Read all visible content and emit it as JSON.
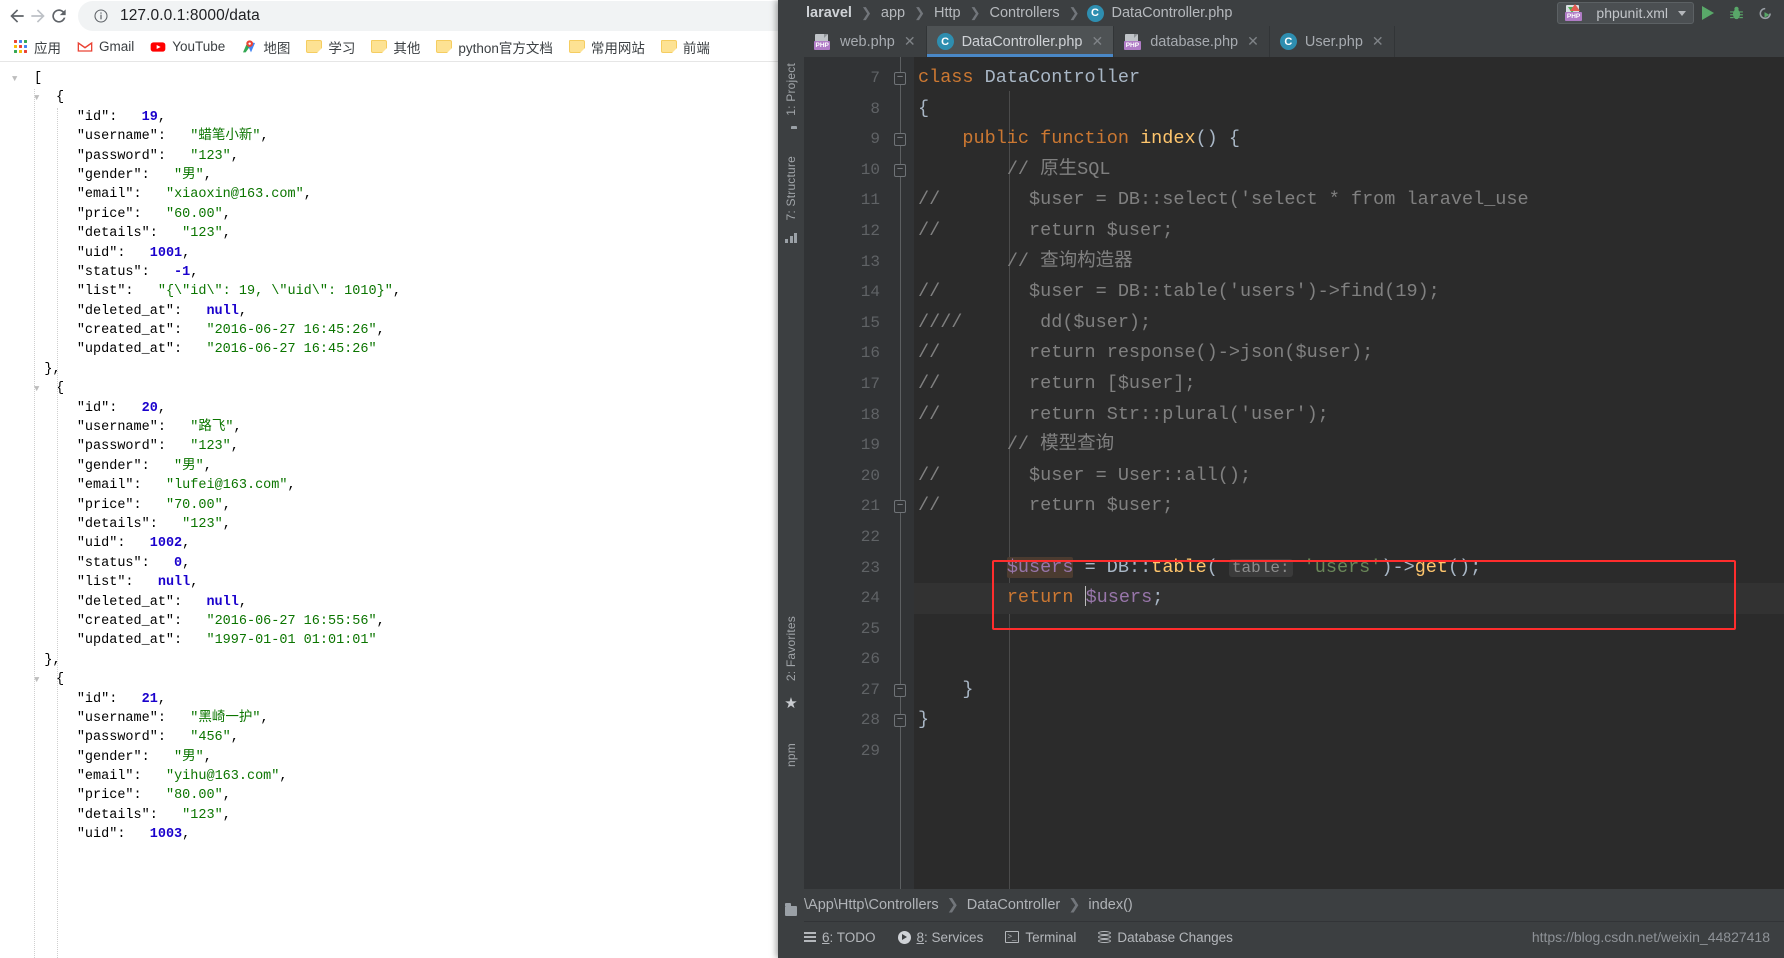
{
  "browser": {
    "nav": {
      "back": "←",
      "forward": "→",
      "reload": "⟳"
    },
    "omnibox": {
      "url": "127.0.0.1:8000/data",
      "info_icon": "info-circle-icon"
    },
    "bookmarks": [
      {
        "label": "应用",
        "icon": "apps-grid-icon"
      },
      {
        "label": "Gmail",
        "icon": "gmail-icon"
      },
      {
        "label": "YouTube",
        "icon": "youtube-icon"
      },
      {
        "label": "地图",
        "icon": "google-maps-icon"
      },
      {
        "label": "学习",
        "icon": "folder-icon"
      },
      {
        "label": "其他",
        "icon": "folder-icon"
      },
      {
        "label": "python官方文档",
        "icon": "folder-icon"
      },
      {
        "label": "常用网站",
        "icon": "folder-icon"
      },
      {
        "label": "前端",
        "icon": "folder-icon"
      }
    ]
  },
  "json_viewer": {
    "records": [
      {
        "id": "19",
        "username": "蜡笔小新",
        "password": "123",
        "gender": "男",
        "email": "xiaoxin@163.com",
        "price": "60.00",
        "details": "123",
        "uid": "1001",
        "status": "-1",
        "list": "{\\\"id\\\": 19, \\\"uid\\\": 1010}",
        "deleted_at": "null",
        "created_at": "2016-06-27 16:45:26",
        "updated_at": "2016-06-27 16:45:26"
      },
      {
        "id": "20",
        "username": "路飞",
        "password": "123",
        "gender": "男",
        "email": "lufei@163.com",
        "price": "70.00",
        "details": "123",
        "uid": "1002",
        "status": "0",
        "list": "null",
        "deleted_at": "null",
        "created_at": "2016-06-27 16:55:56",
        "updated_at": "1997-01-01 01:01:01"
      },
      {
        "id": "21",
        "username": "黑崎一护",
        "password": "456",
        "gender": "男",
        "email": "yihu@163.com",
        "price": "80.00",
        "details": "123",
        "uid": "1003"
      }
    ]
  },
  "ide": {
    "breadcrumb": [
      {
        "label": "laravel",
        "icon": ""
      },
      {
        "label": "app",
        "icon": ""
      },
      {
        "label": "Http",
        "icon": ""
      },
      {
        "label": "Controllers",
        "icon": ""
      },
      {
        "label": "DataController.php",
        "icon": "php-class-icon"
      }
    ],
    "run_config": {
      "label": "phpunit.xml",
      "icon": "xml-file-icon"
    },
    "run_buttons": [
      {
        "name": "run-button",
        "icon": "play-icon"
      },
      {
        "name": "debug-button",
        "icon": "bug-icon"
      },
      {
        "name": "rerun-button",
        "icon": "rerun-icon"
      }
    ],
    "tabs": [
      {
        "label": "web.php",
        "icon": "php-file-icon",
        "active": false
      },
      {
        "label": "DataController.php",
        "icon": "php-class-icon",
        "active": true
      },
      {
        "label": "database.php",
        "icon": "php-file-icon",
        "active": false
      },
      {
        "label": "User.php",
        "icon": "php-class-icon",
        "active": false
      }
    ],
    "left_rail": [
      {
        "label": "1: Project",
        "name": "tool-window-project"
      },
      {
        "label": "7: Structure",
        "name": "tool-window-structure"
      },
      {
        "label": "2: Favorites",
        "name": "tool-window-favorites"
      },
      {
        "label": "npm",
        "name": "tool-window-npm"
      }
    ],
    "editor": {
      "first_line": 7,
      "lines": [
        {
          "n": 7,
          "fold": "minus",
          "html": "<span class=\"kw\">class</span> <span class=\"cls\">DataController</span>"
        },
        {
          "n": 8,
          "fold": "",
          "html": "<span class=\"txt\">{</span>"
        },
        {
          "n": 9,
          "fold": "minus",
          "html": "    <span class=\"kw\">public function</span> <span class=\"fn\">index</span><span class=\"txt\">() {</span>"
        },
        {
          "n": 10,
          "fold": "minus",
          "html": "        <span class=\"cmt\">// 原生SQL</span>"
        },
        {
          "n": 11,
          "fold": "",
          "html": "<span class=\"cmt\">//        $user = DB::select('select * from laravel_use</span>"
        },
        {
          "n": 12,
          "fold": "",
          "html": "<span class=\"cmt\">//        return $user;</span>"
        },
        {
          "n": 13,
          "fold": "",
          "html": "        <span class=\"cmt\">// 查询构造器</span>"
        },
        {
          "n": 14,
          "fold": "",
          "html": "<span class=\"cmt\">//        $user = DB::table('users')->find(19);</span>"
        },
        {
          "n": 15,
          "fold": "",
          "html": "<span class=\"cmt\">////       dd($user);</span>"
        },
        {
          "n": 16,
          "fold": "",
          "html": "<span class=\"cmt\">//        return response()->json($user);</span>"
        },
        {
          "n": 17,
          "fold": "",
          "html": "<span class=\"cmt\">//        return [$user];</span>"
        },
        {
          "n": 18,
          "fold": "",
          "html": "<span class=\"cmt\">//        return Str::plural('user');</span>"
        },
        {
          "n": 19,
          "fold": "",
          "html": "        <span class=\"cmt\">// 模型查询</span>"
        },
        {
          "n": 20,
          "fold": "",
          "html": "<span class=\"cmt\">//        $user = User::all();</span>"
        },
        {
          "n": 21,
          "fold": "minus",
          "html": "<span class=\"cmt\">//        return $user;</span>"
        },
        {
          "n": 22,
          "fold": "",
          "html": ""
        },
        {
          "n": 23,
          "fold": "",
          "html": "        <span class=\"var var-hl\">$users</span> <span class=\"txt\">=</span> <span class=\"cls\">DB</span><span class=\"txt\">::</span><span class=\"fn\">table</span><span class=\"txt\">(</span> <span class=\"param-hint\">table:</span> <span class=\"str\">'users'</span><span class=\"txt\">)-&gt;</span><span class=\"fn\">get</span><span class=\"txt\">();</span>"
        },
        {
          "n": 24,
          "fold": "",
          "selected": true,
          "html": "        <span class=\"kw\">return</span> <span class=\"caret-bar\"></span><span class=\"var\">$users</span><span class=\"txt\">;</span>"
        },
        {
          "n": 25,
          "fold": "",
          "html": ""
        },
        {
          "n": 26,
          "fold": "",
          "html": ""
        },
        {
          "n": 27,
          "fold": "minus",
          "html": "    <span class=\"txt\">}</span>"
        },
        {
          "n": 28,
          "fold": "minus",
          "html": "<span class=\"txt\">}</span>"
        },
        {
          "n": 29,
          "fold": "",
          "html": ""
        }
      ]
    },
    "nav_crumb": [
      "\\App\\Http\\Controllers",
      "DataController",
      "index()"
    ],
    "status_bar": {
      "items": [
        {
          "num": "6",
          "label": ": TODO",
          "icon": "todo-icon"
        },
        {
          "num": "8",
          "label": ": Services",
          "icon": "services-icon"
        },
        {
          "num": "",
          "label": "Terminal",
          "icon": "terminal-icon"
        },
        {
          "num": "",
          "label": "Database Changes",
          "icon": "database-icon"
        }
      ],
      "watermark": "https://blog.csdn.net/weixin_44827418"
    },
    "colors": {
      "accent": "#4a88c7",
      "chrome": "#3c3f41",
      "editor_bg": "#2b2b2b",
      "highlight_box": "#ff2d2d",
      "run_green": "#59a869"
    }
  }
}
